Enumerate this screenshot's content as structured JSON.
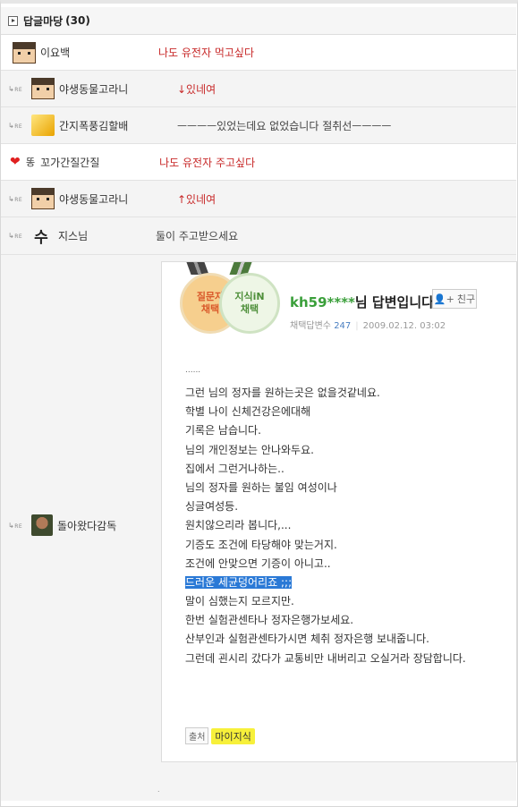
{
  "header": {
    "title": "답글마당",
    "count": "(30)"
  },
  "replies": [
    {
      "re": false,
      "nick": "이요백",
      "comment": "나도 유전자 먹고싶다",
      "comment_color": "red"
    },
    {
      "re": true,
      "nick": "야생동물고라니",
      "comment": "↓있네여",
      "comment_color": "red"
    },
    {
      "re": true,
      "nick": "간지폭풍김할배",
      "comment": "ㅡㅡㅡㅡ있었는데요 없었습니다 절취선ㅡㅡㅡㅡ",
      "comment_color": "dark"
    },
    {
      "re": false,
      "prefix": "똥",
      "nick": "꼬가간질간질",
      "comment": "나도 유전자 주고싶다",
      "comment_color": "red"
    },
    {
      "re": true,
      "nick": "야생동물고라니",
      "comment": "↑있네여",
      "comment_color": "red"
    },
    {
      "re": true,
      "avatar_char": "수",
      "nick": "지스님",
      "comment": "둘이 주고받으세요",
      "comment_color": "dark"
    },
    {
      "re": true,
      "nick": "돌아왔다감독"
    }
  ],
  "re_label": "RE",
  "answer_card": {
    "medal1": [
      "질문자",
      "채택"
    ],
    "medal2": [
      "지식iN",
      "채택"
    ],
    "user_id": "kh59****",
    "title_suffix": "님 답변입니다.",
    "friend_button": "친구",
    "adopted_label": "채택답변수",
    "adopted_count": "247",
    "date": "2009.02.12. 03:02",
    "lines": [
      "......",
      "그런 님의 정자를 원하는곳은 없을것같네요.",
      "학별 나이 신체건강은에대해",
      "기록은 남습니다.",
      "님의 개인정보는 안나와두요.",
      "집에서 그런거나하는..",
      "님의 정자를 원하는 불임 여성이나",
      "싱글여성등.",
      "원치않으리라 봅니다,...",
      "기증도 조건에 타당해야 맞는거지.",
      "조건에 안맞으면 기증이 아니고..",
      "드러운 세균덩어리죠 ;;;",
      "말이 심했는지 모르지만.",
      "한번 실험관센타나 정자은행가보세요.",
      "산부인과 실험관센타가시면 체취 정자은행 보내줍니다.",
      "그런데 괸시리 갔다가 교통비만 내버리고 오실거라 장담합니다."
    ],
    "highlighted_line_index": 11,
    "source_label": "출처",
    "source_value": "마이지식"
  },
  "colors": {
    "red": "#c82a2a",
    "highlight": "#2a79d6",
    "source_bg": "#f7f03a"
  }
}
